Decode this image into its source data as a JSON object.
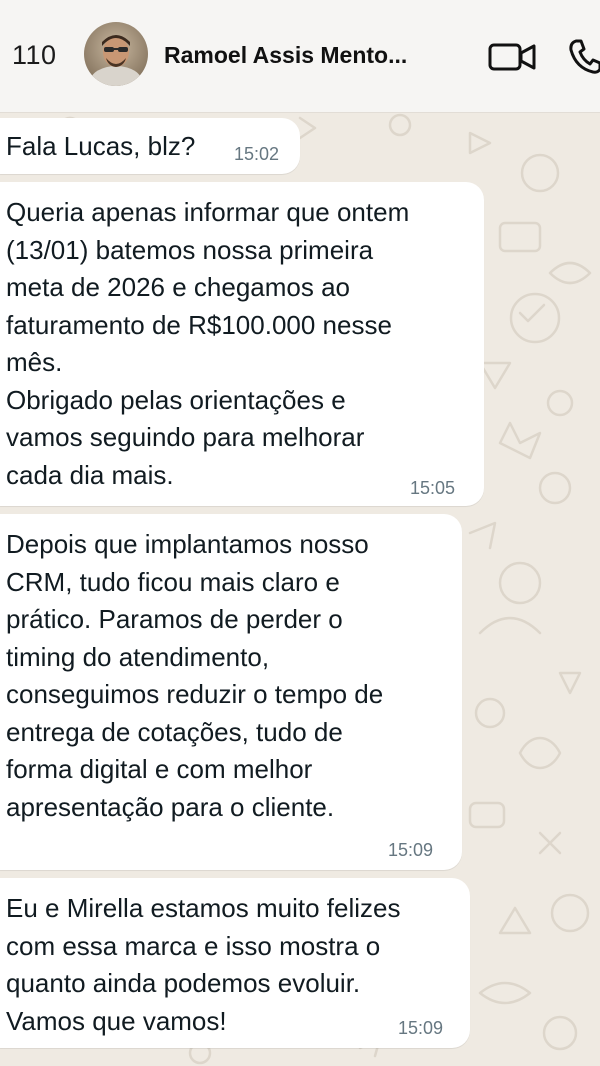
{
  "header": {
    "back_count": "110",
    "contact_name": "Ramoel Assis Mento...",
    "icons": {
      "video": "video-call-icon",
      "phone": "phone-call-icon"
    }
  },
  "messages": [
    {
      "text": "Fala Lucas, blz?",
      "time": "15:02"
    },
    {
      "text": "Queria apenas informar que ontem\n(13/01) batemos nossa primeira\nmeta de 2026 e chegamos ao\nfaturamento de R$100.000 nesse\nmês.\nObrigado pelas orientações e\nvamos seguindo para melhorar\ncada dia mais.",
      "time": "15:05"
    },
    {
      "text": "Depois que implantamos nosso\nCRM, tudo ficou mais claro e\nprático. Paramos de perder o\ntiming do atendimento,\nconseguimos reduzir o tempo de\nentrega de cotações, tudo de\nforma digital e com melhor\napresentação para o cliente.",
      "time": "15:09"
    },
    {
      "text": "Eu e Mirella estamos muito felizes\ncom essa marca e isso mostra o\nquanto ainda podemos evoluir.\nVamos que vamos!",
      "time": "15:09"
    }
  ],
  "colors": {
    "wallpaper": "#efeae2",
    "bubble": "#ffffff",
    "text": "#111b21",
    "time": "#667781"
  }
}
